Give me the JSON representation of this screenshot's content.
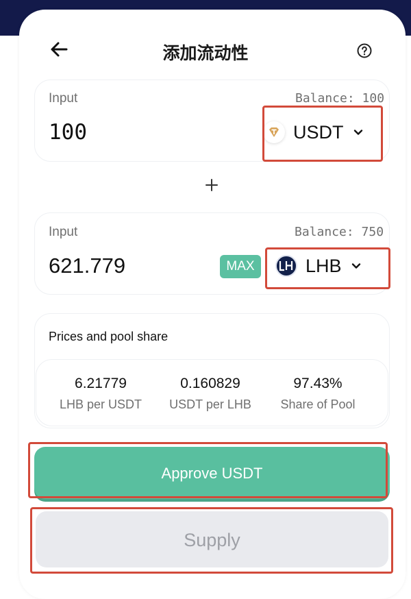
{
  "header": {
    "title": "添加流动性",
    "back_icon": "arrow-left-icon",
    "help_icon": "question-circle-icon"
  },
  "input_a": {
    "label": "Input",
    "balance": "Balance: 100",
    "amount": "100",
    "token": {
      "symbol": "USDT",
      "icon": "tether-icon",
      "color": "#d8a45a"
    }
  },
  "plus_icon": "plus-icon",
  "input_b": {
    "label": "Input",
    "balance": "Balance: 750",
    "amount": "621.779",
    "max_label": "MAX",
    "token": {
      "symbol": "LHB",
      "icon": "lhb-logo-icon",
      "color": "#12204a"
    }
  },
  "pool": {
    "title": "Prices and pool share",
    "stats": [
      {
        "value": "6.21779",
        "label": "LHB per USDT"
      },
      {
        "value": "0.160829",
        "label": "USDT per LHB"
      },
      {
        "value": "97.43%",
        "label": "Share of Pool"
      }
    ]
  },
  "actions": {
    "approve_label": "Approve USDT",
    "supply_label": "Supply"
  },
  "colors": {
    "accent": "#59bf9f",
    "highlight": "#d24a3a",
    "disabled": "#e9eaee",
    "top_bar": "#131a4a"
  }
}
